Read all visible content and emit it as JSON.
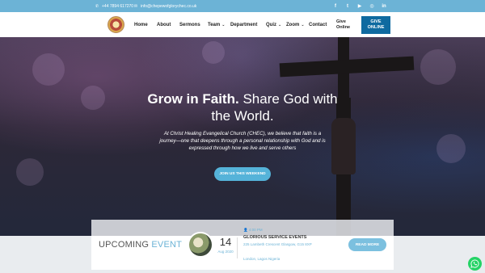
{
  "topbar": {
    "phone": "+44 7894 617270",
    "email": "info@chepewofglorychec.co.uk",
    "social": [
      {
        "icon": "facebook-icon",
        "glyph": "f"
      },
      {
        "icon": "twitter-icon",
        "glyph": "t"
      },
      {
        "icon": "youtube-icon",
        "glyph": "▶"
      },
      {
        "icon": "instagram-icon",
        "glyph": "◎"
      },
      {
        "icon": "linkedin-icon",
        "glyph": "in"
      }
    ]
  },
  "nav": {
    "items": [
      {
        "label": "Home",
        "dropdown": false
      },
      {
        "label": "About",
        "dropdown": false
      },
      {
        "label": "Sermons",
        "dropdown": false
      },
      {
        "label": "Team",
        "dropdown": true
      },
      {
        "label": "Department",
        "dropdown": false
      },
      {
        "label": "Quiz",
        "dropdown": true
      },
      {
        "label": "Zoom",
        "dropdown": true
      },
      {
        "label": "Contact",
        "dropdown": false
      }
    ],
    "give_online_line1": "Give",
    "give_online_line2": "Online",
    "give_button_line1": "GIVE",
    "give_button_line2": "ONLINE"
  },
  "hero": {
    "title_bold": "Grow in Faith.",
    "title_rest": " Share God with the World.",
    "text": "At Christ Healing Evangelical Church (CHEC), we believe that faith is a journey—one that deepens through a personal relationship with God and is expressed through how we live and serve others",
    "cta": "JOIN US THIS WEEKEND"
  },
  "event": {
    "heading_main": "UPCOMING",
    "heading_accent": " EVENT",
    "day": "14",
    "month": "Aug 2020",
    "time": "4:00 PM",
    "title": "GLORIOUS SERVICE EVENTS",
    "address": "225 Lambeth Crescent Glasgow, G15 8XP",
    "address2": "London, Lagos Nigeria",
    "button": "READ MORE"
  },
  "colors": {
    "accent": "#6cb3d6",
    "give_button": "#0f6aa0",
    "whatsapp": "#25d366"
  }
}
